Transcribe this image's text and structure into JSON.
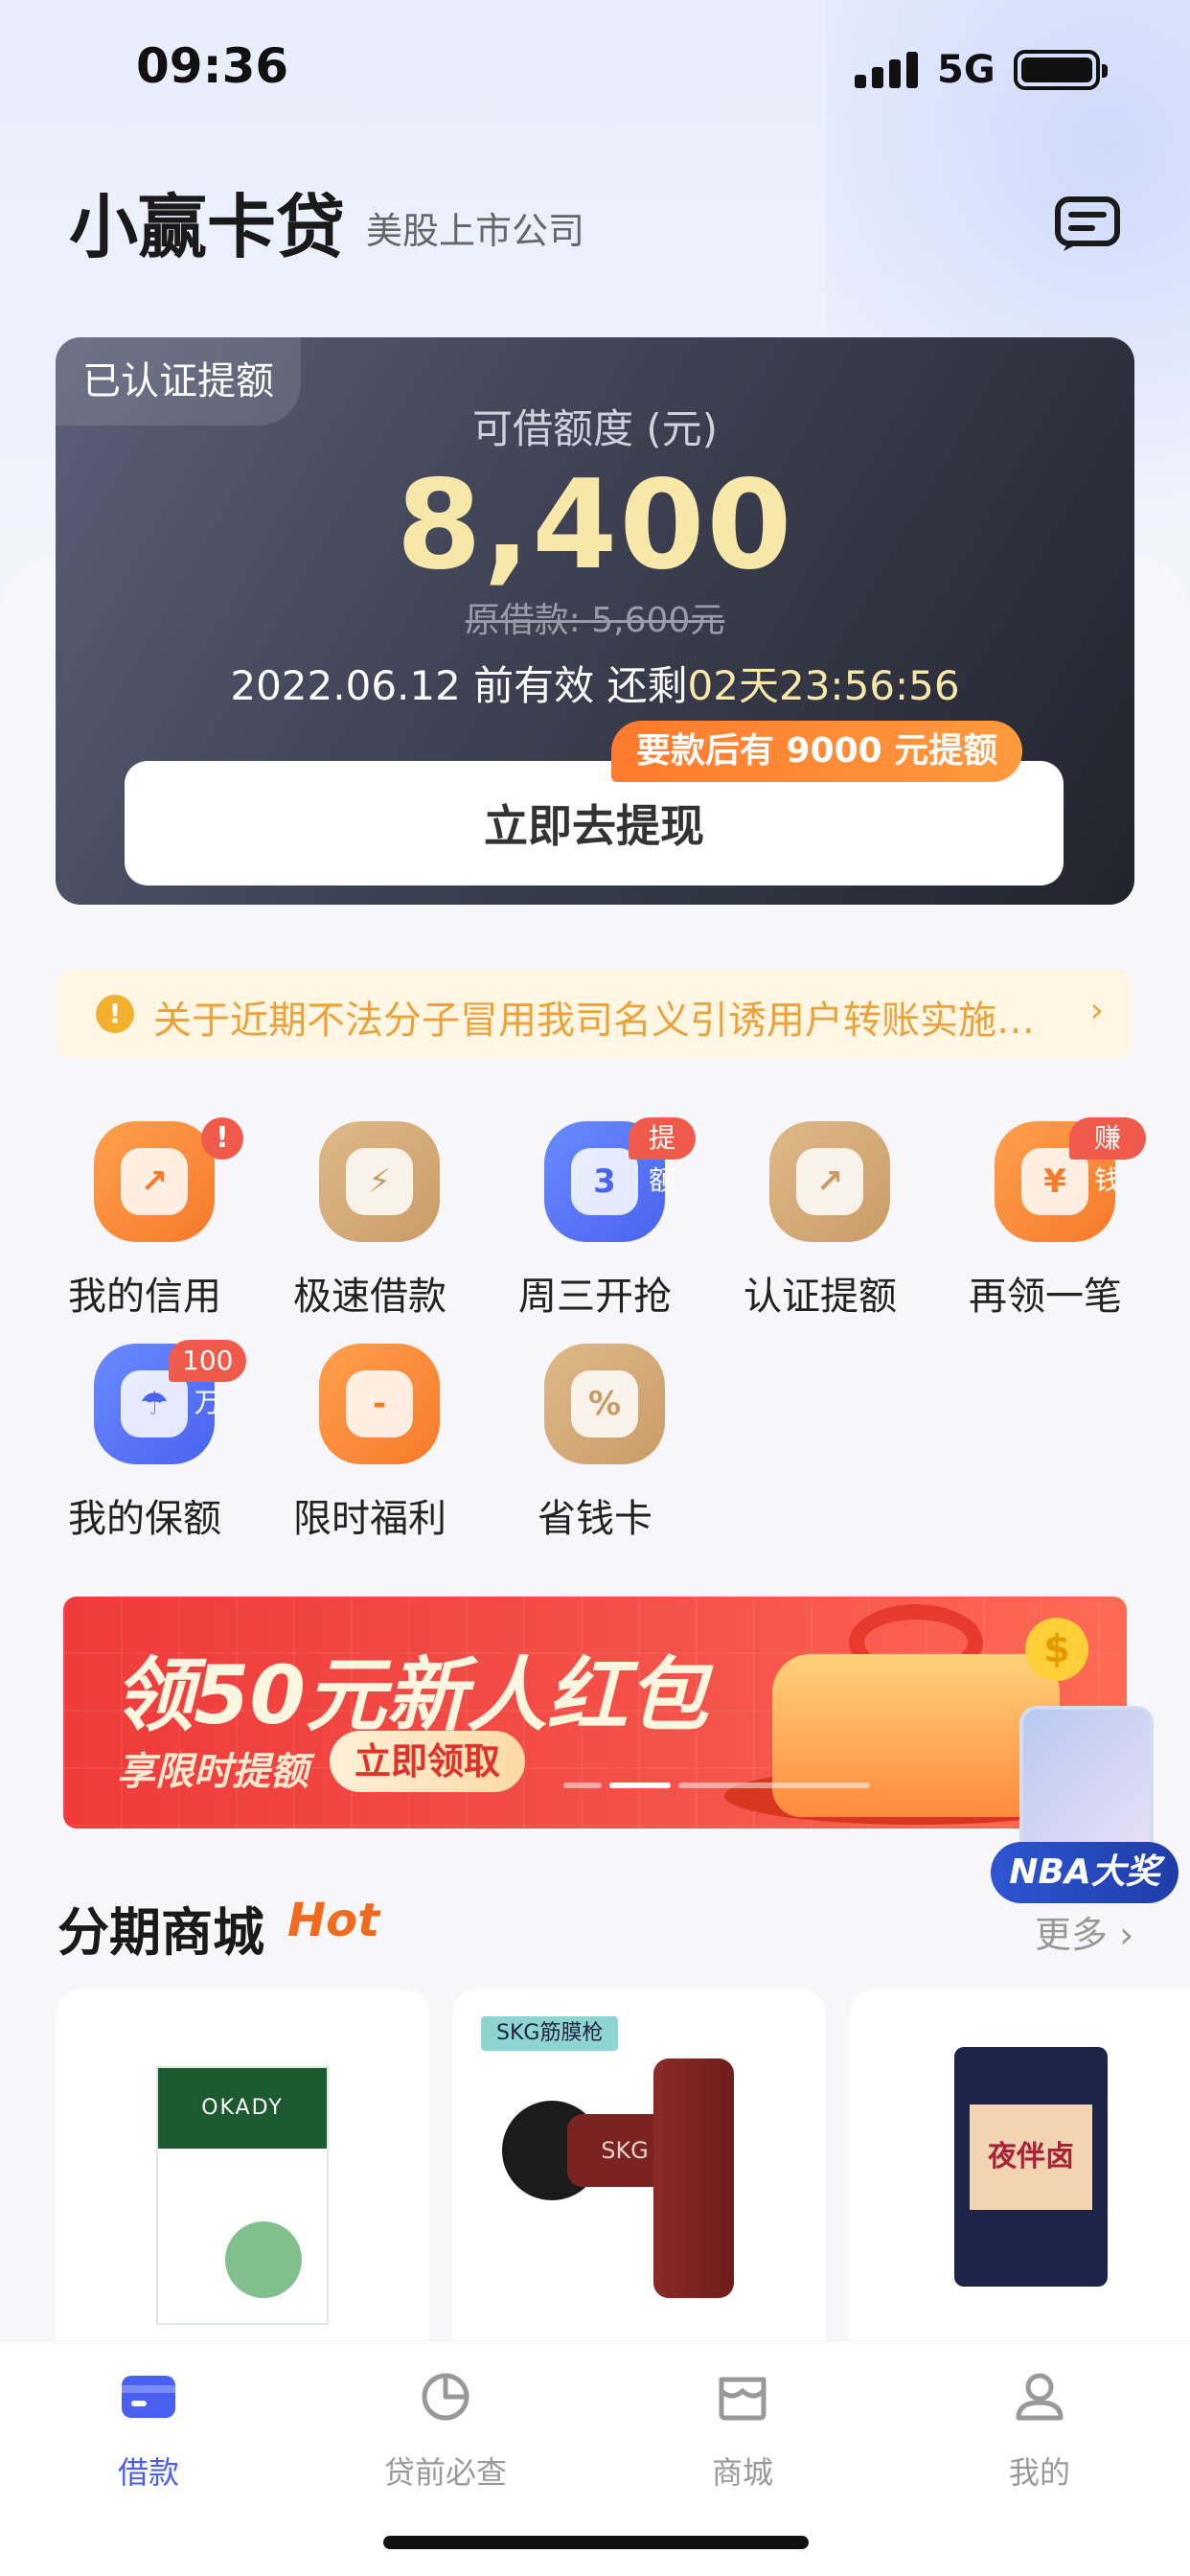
{
  "status_bar": {
    "time": "09:36",
    "network": "5G"
  },
  "header": {
    "title": "小赢卡贷",
    "subtitle": "美股上市公司"
  },
  "credit_card": {
    "tag": "已认证提额",
    "limit_label": "可借额度 (元)",
    "limit_value": "8,400",
    "original_loan": "原借款: 5,600元",
    "validity_prefix": "2022.06.12 前有效 还剩",
    "countdown": "02天23:56:56",
    "promo_badge": "要款后有 9000 元提额",
    "withdraw_button": "立即去提现"
  },
  "notice": {
    "text": "关于近期不法分子冒用我司名义引诱用户转账实施…"
  },
  "grid": [
    {
      "label": "我的信用",
      "badge": "!",
      "glyph": "↗"
    },
    {
      "label": "极速借款",
      "badge": "",
      "glyph": "⚡"
    },
    {
      "label": "周三开抢",
      "badge": "提额",
      "glyph": "3"
    },
    {
      "label": "认证提额",
      "badge": "",
      "glyph": "↗"
    },
    {
      "label": "再领一笔",
      "badge": "赚钱",
      "glyph": "¥"
    },
    {
      "label": "我的保额",
      "badge": "100万",
      "glyph": "☂"
    },
    {
      "label": "限时福利",
      "badge": "",
      "glyph": "-"
    },
    {
      "label": "省钱卡",
      "badge": "",
      "glyph": "%"
    }
  ],
  "banner": {
    "title": "领50元新人红包",
    "subtitle": "享限时提额",
    "button": "立即领取",
    "coin": "$"
  },
  "floating_ad": {
    "label": "NBA大奖"
  },
  "mall": {
    "title": "分期商城",
    "hot": "Hot",
    "more": "更多",
    "products": [
      {
        "brand": "OKADY"
      },
      {
        "brand": "SKG筋膜枪",
        "logo": "SKG"
      },
      {
        "brand": "夜伴卤"
      }
    ]
  },
  "tab_bar": [
    {
      "label": "借款",
      "active": true
    },
    {
      "label": "贷前必查",
      "active": false
    },
    {
      "label": "商城",
      "active": false
    },
    {
      "label": "我的",
      "active": false
    }
  ],
  "colors": {
    "accent": "#4a5ff0",
    "gold": "#f7e7a9",
    "promo_orange": "#ff7a2e",
    "banner_red": "#ef3b3b",
    "notice_text": "#eca23b"
  }
}
